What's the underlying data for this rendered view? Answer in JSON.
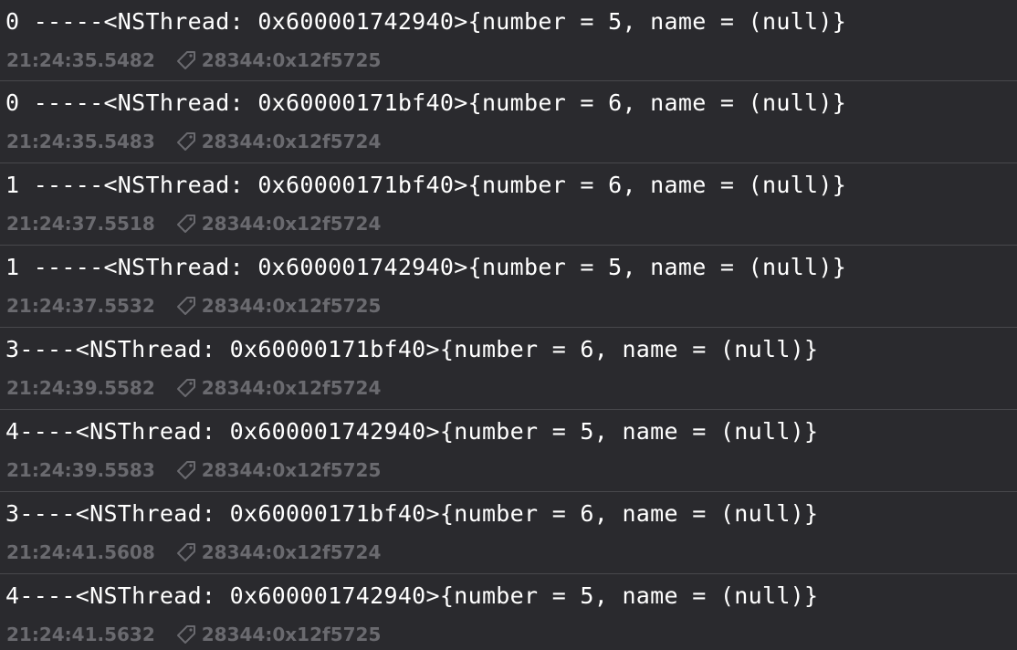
{
  "console": {
    "entries": [
      {
        "message": "0 -----<NSThread: 0x600001742940>{number = 5, name = (null)}",
        "timestamp": "21:24:35.5482",
        "thread": "28344:0x12f5725"
      },
      {
        "message": "0 -----<NSThread: 0x60000171bf40>{number = 6, name = (null)}",
        "timestamp": "21:24:35.5483",
        "thread": "28344:0x12f5724"
      },
      {
        "message": "1 -----<NSThread: 0x60000171bf40>{number = 6, name = (null)}",
        "timestamp": "21:24:37.5518",
        "thread": "28344:0x12f5724"
      },
      {
        "message": "1 -----<NSThread: 0x600001742940>{number = 5, name = (null)}",
        "timestamp": "21:24:37.5532",
        "thread": "28344:0x12f5725"
      },
      {
        "message": "3----<NSThread: 0x60000171bf40>{number = 6, name = (null)}",
        "timestamp": "21:24:39.5582",
        "thread": "28344:0x12f5724"
      },
      {
        "message": "4----<NSThread: 0x600001742940>{number = 5, name = (null)}",
        "timestamp": "21:24:39.5583",
        "thread": "28344:0x12f5725"
      },
      {
        "message": "3----<NSThread: 0x60000171bf40>{number = 6, name = (null)}",
        "timestamp": "21:24:41.5608",
        "thread": "28344:0x12f5724"
      },
      {
        "message": "4----<NSThread: 0x600001742940>{number = 5, name = (null)}",
        "timestamp": "21:24:41.5632",
        "thread": "28344:0x12f5725"
      }
    ],
    "meta_icon": "tag-icon"
  },
  "colors": {
    "background": "#2a2a2e",
    "message_text": "#ffffff",
    "meta_text": "#6a6a6f",
    "divider": "#48484c"
  }
}
